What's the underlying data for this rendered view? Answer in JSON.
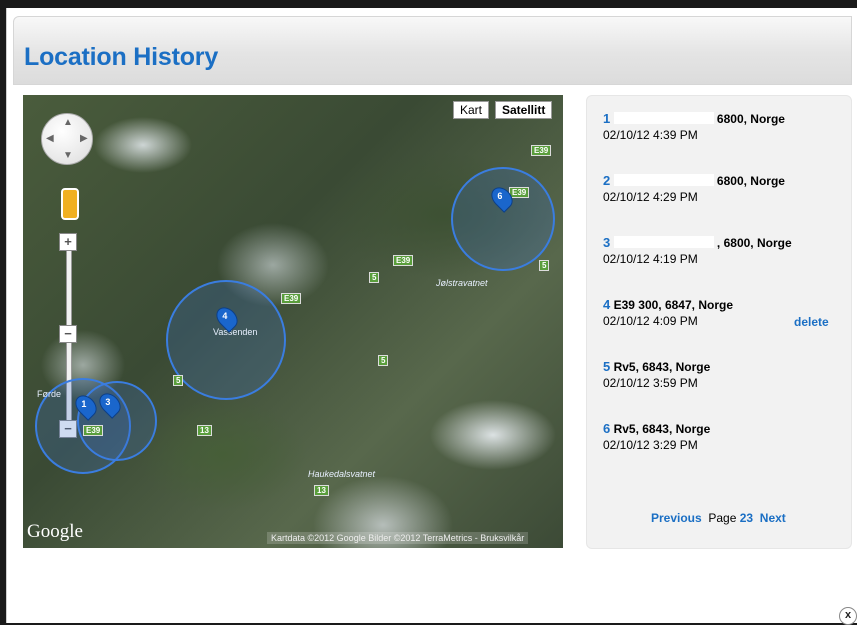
{
  "header": {
    "title": "Location History"
  },
  "map": {
    "type_kart": "Kart",
    "type_satellite": "Satellitt",
    "zoom_in": "+",
    "zoom_out": "−",
    "place_labels": [
      "Jølstravatnet",
      "Vassenden",
      "Haukedalsvatnet",
      "Førde"
    ],
    "roads": [
      "E39",
      "E39",
      "E39",
      "E39",
      "5",
      "5",
      "5",
      "5",
      "13",
      "13",
      "E39"
    ],
    "logo": "Google",
    "copyright": "Kartdata ©2012 Google Bilder ©2012 TerraMetrics - Bruksvilkår",
    "markers": [
      "1",
      "3",
      "4",
      "6"
    ]
  },
  "history": {
    "entries": [
      {
        "num": "1",
        "address": "6800, Norge",
        "time": "02/10/12 4:39 PM"
      },
      {
        "num": "2",
        "address": "6800, Norge",
        "time": "02/10/12 4:29 PM"
      },
      {
        "num": "3",
        "address": ", 6800, Norge",
        "time": "02/10/12 4:19 PM"
      },
      {
        "num": "4",
        "address": "E39 300, 6847, Norge",
        "time": "02/10/12 4:09 PM"
      },
      {
        "num": "5",
        "address": "Rv5, 6843, Norge",
        "time": "02/10/12 3:59 PM"
      },
      {
        "num": "6",
        "address": "Rv5, 6843, Norge",
        "time": "02/10/12 3:29 PM"
      }
    ],
    "delete_label": "delete"
  },
  "pager": {
    "previous": "Previous",
    "page_label": "Page",
    "page_number": "23",
    "next": "Next"
  },
  "close_label": "x",
  "colors": {
    "accent": "#1b6fc4",
    "marker": "#1a66cc"
  }
}
